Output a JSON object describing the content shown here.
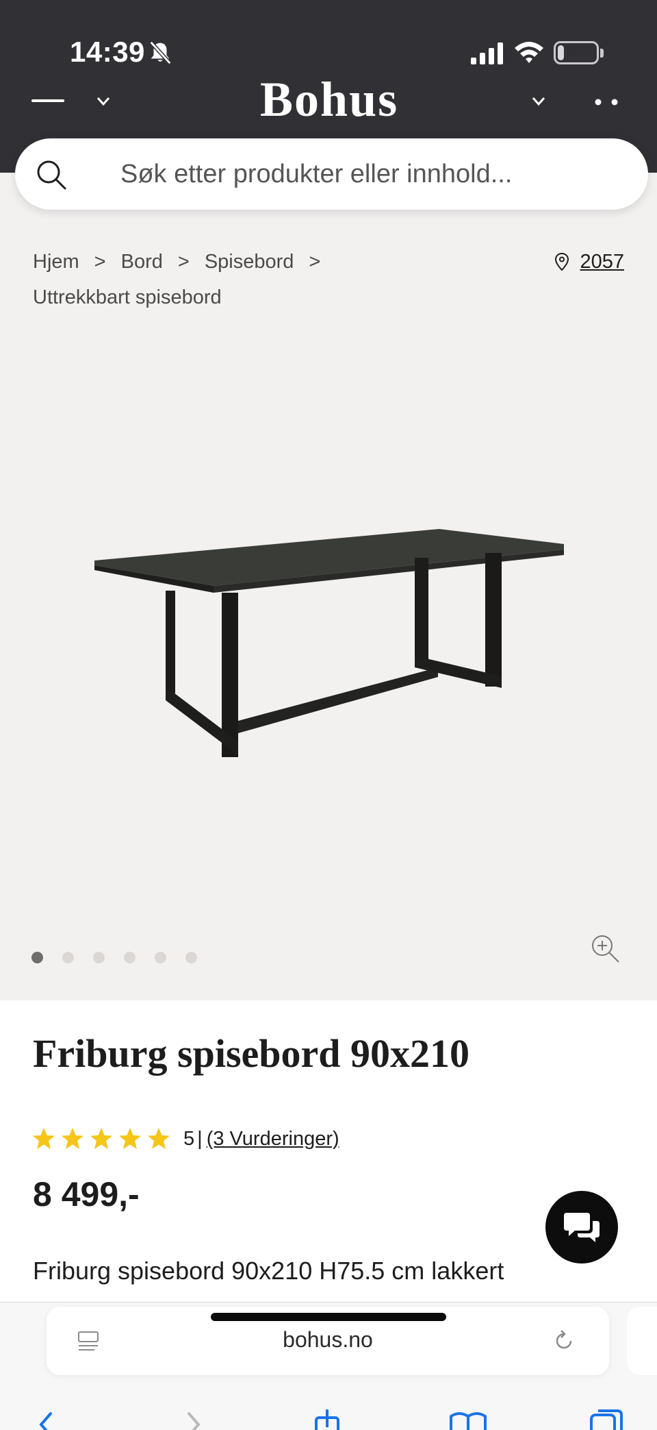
{
  "status_bar": {
    "time": "14:39",
    "battery": "25",
    "battery_level": 0.25
  },
  "header": {
    "brand": "Bohus"
  },
  "search": {
    "placeholder": "Søk etter produkter eller innhold..."
  },
  "breadcrumb": {
    "items": [
      "Hjem",
      "Bord",
      "Spisebord",
      "Uttrekkbart spisebord"
    ],
    "separator": ">"
  },
  "store": {
    "number": "2057"
  },
  "gallery": {
    "image_count": 6,
    "active_index": 0
  },
  "product": {
    "title": "Friburg spisebord 90x210",
    "rating_value": "5",
    "rating_stars": 5,
    "rating_separator": "|",
    "reviews_link": "(3 Vurderinger)",
    "price": "8 499,-",
    "description": "Friburg spisebord 90x210 H75.5 cm lakkert"
  },
  "browser": {
    "url": "bohus.no"
  },
  "colors": {
    "header_bg": "#313135",
    "product_bg": "#f3f1f0",
    "star": "#f5c518",
    "chat_button": "#0d0d0d",
    "link_blue": "#1a73e8"
  },
  "icons": [
    "bell-slash-icon",
    "signal-icon",
    "wifi-icon",
    "battery-icon",
    "menu-icon",
    "chevron-down-icon",
    "more-icon",
    "search-icon",
    "location-pin-icon",
    "zoom-in-icon",
    "star-icon",
    "chat-icon",
    "reader-icon",
    "reload-icon",
    "back-icon",
    "forward-icon",
    "share-icon",
    "bookmarks-icon",
    "tabs-icon"
  ]
}
